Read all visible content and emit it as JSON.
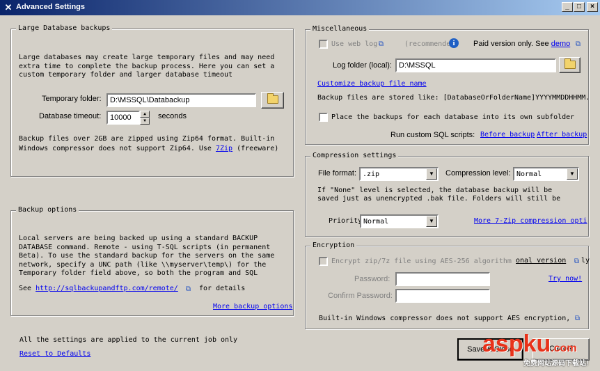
{
  "window": {
    "title": "Advanced Settings"
  },
  "large_db": {
    "legend": "Large Database backups",
    "description": "Large databases may create large temporary files and may need extra time to complete the backup process. Here you can set a custom temporary folder and larger database timeout",
    "temp_folder_label": "Temporary folder:",
    "temp_folder_value": "D:\\MSSQL\\Databackup",
    "timeout_label": "Database timeout:",
    "timeout_value": "10000",
    "timeout_unit": "seconds",
    "zip64_note_1": "Backup files over 2GB are zipped using Zip64 format. Built-in",
    "zip64_note_2": "Windows compressor does not support Zip64. Use",
    "zip_link": "7Zip",
    "zip64_note_3": "(freeware)"
  },
  "backup_options": {
    "legend": "Backup options",
    "description": "Local servers are being backed up using a standard BACKUP DATABASE command. Remote - using T-SQL scripts (in permanent Beta). To use the standard backup for the servers on the same network, specify a UNC path  (like \\\\myserver\\temp\\) for the Temporary folder field above, so both the program and SQL",
    "see_label": "See",
    "see_link": "http://sqlbackupandftp.com/remote/",
    "details_label": "for details",
    "more_link": "More backup options"
  },
  "misc": {
    "legend": "Miscellaneous",
    "use_web_log_label": "Use web log",
    "recommended_label": "(recommende",
    "paid_label": "Paid version only. See",
    "demo_link": "demo",
    "log_folder_label": "Log folder (local):",
    "log_folder_value": "D:\\MSSQL",
    "customize_link": "Customize backup file name",
    "stored_like": "Backup files are stored like: [DatabaseOrFolderName]YYYYMMDDHHMM.",
    "subfolder_label": "Place the backups for each database into its own subfolder",
    "custom_sql_label": "Run custom SQL scripts:",
    "before_link": "Before backup",
    "after_link": "After backup"
  },
  "compression": {
    "legend": "Compression settings",
    "format_label": "File format:",
    "format_value": ".zip",
    "level_label": "Compression level:",
    "level_value": "Normal",
    "none_note_1": "If \"None\" level is selected, the database backup will be",
    "none_note_2": "saved just as unencrypted .bak file. Folders will still be",
    "priority_label": "Priority",
    "priority_value": "Normal",
    "more_link": "More 7-Zip compression opti"
  },
  "encryption": {
    "legend": "Encryption",
    "encrypt_label": "Encrypt zip/7z file using AES-256 algorithm",
    "onal_version_label": "onal version",
    "ly_label": "ly",
    "password_label": "Password:",
    "confirm_label": "Confirm Password:",
    "try_link": "Try now!",
    "builtin_note": "Built-in Windows compressor does not support AES encryption,"
  },
  "footer": {
    "applied_note": "All the settings are applied to the current job only",
    "reset_link": "Reset to Defaults",
    "save_label": "Save & Close",
    "cancel_label": "Cancel"
  },
  "watermark": {
    "logo": "aspku",
    "tld": ".com",
    "subtitle": "免费网站源码下载站!"
  }
}
